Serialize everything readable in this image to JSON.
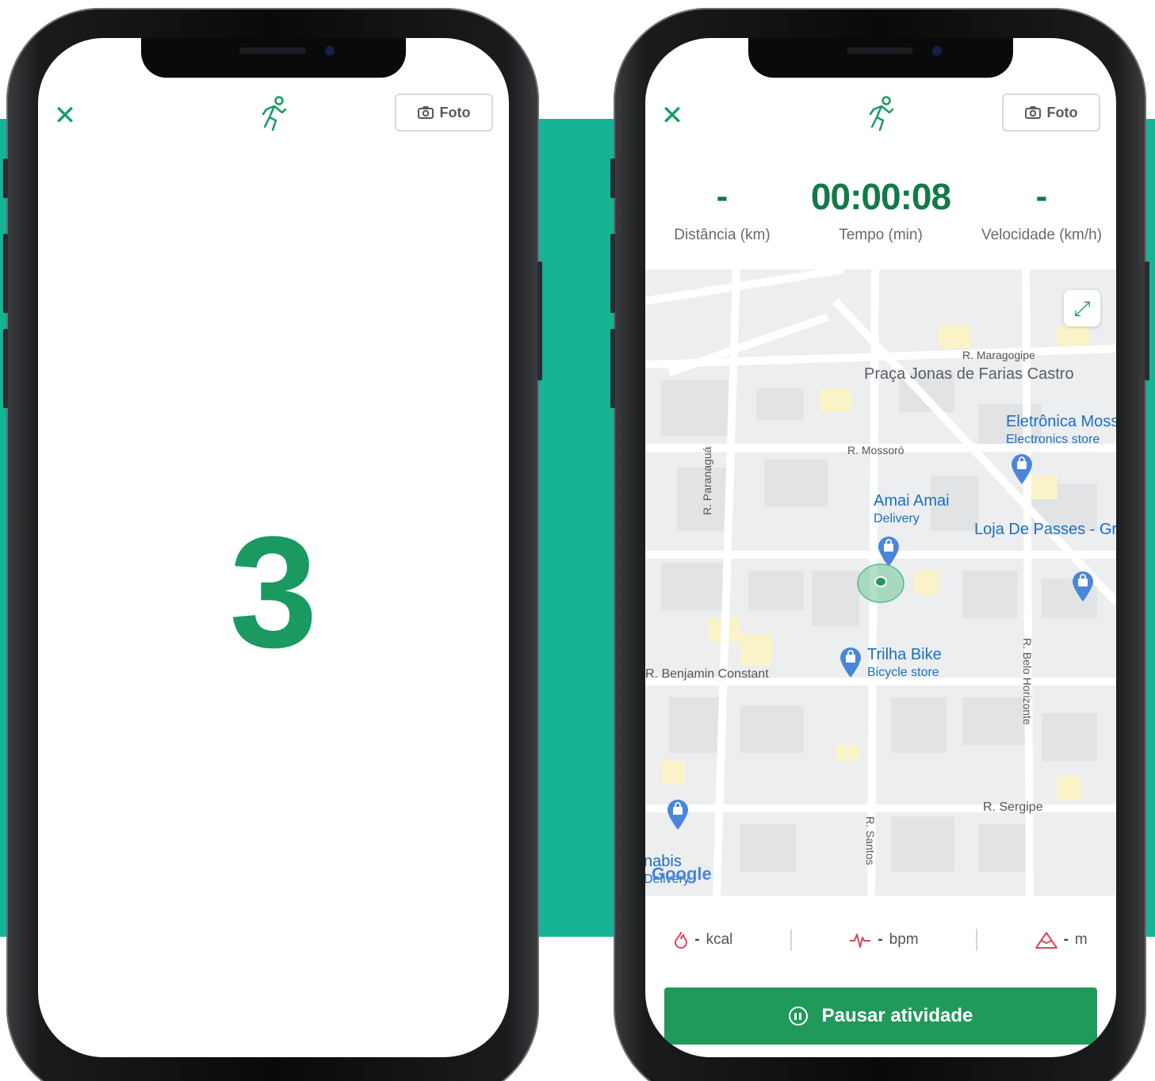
{
  "colors": {
    "accent": "#1a9a60",
    "band": "#14b495",
    "button": "#1f9a5a"
  },
  "left_screen": {
    "close_icon": "close-icon",
    "header_icon": "runner-icon",
    "photo_button_label": "Foto",
    "countdown": "3"
  },
  "right_screen": {
    "close_icon": "close-icon",
    "header_icon": "runner-icon",
    "photo_button_label": "Foto",
    "stats": {
      "distance_value": "-",
      "distance_label": "Distância (km)",
      "time_value": "00:00:08",
      "time_label": "Tempo (min)",
      "speed_value": "-",
      "speed_label": "Velocidade (km/h)"
    },
    "map": {
      "streets": [
        "R. Maragogipe",
        "R. Mossoró",
        "R. Paranaguá",
        "R. Benjamin Constant",
        "R. Belo Horizonte",
        "R. Sergipe",
        "R. Santos"
      ],
      "places": {
        "praca": "Praça Jonas de Farias Castro",
        "eletronica_name": "Eletrônica Moss",
        "eletronica_type": "Electronics store",
        "amai_name": "Amai Amai",
        "amai_type": "Delivery",
        "loja_name": "Loja De Passes - Grande Londrina",
        "trilha_name": "Trilha Bike",
        "trilha_type": "Bicycle store",
        "nabis_name": "nabis",
        "nabis_type": "Delivery"
      },
      "attribution": "Google"
    },
    "metrics": {
      "kcal_value": "-",
      "kcal_unit": "kcal",
      "bpm_value": "-",
      "bpm_unit": "bpm",
      "elev_value": "-",
      "elev_unit": "m"
    },
    "pause_button_label": "Pausar atividade"
  }
}
